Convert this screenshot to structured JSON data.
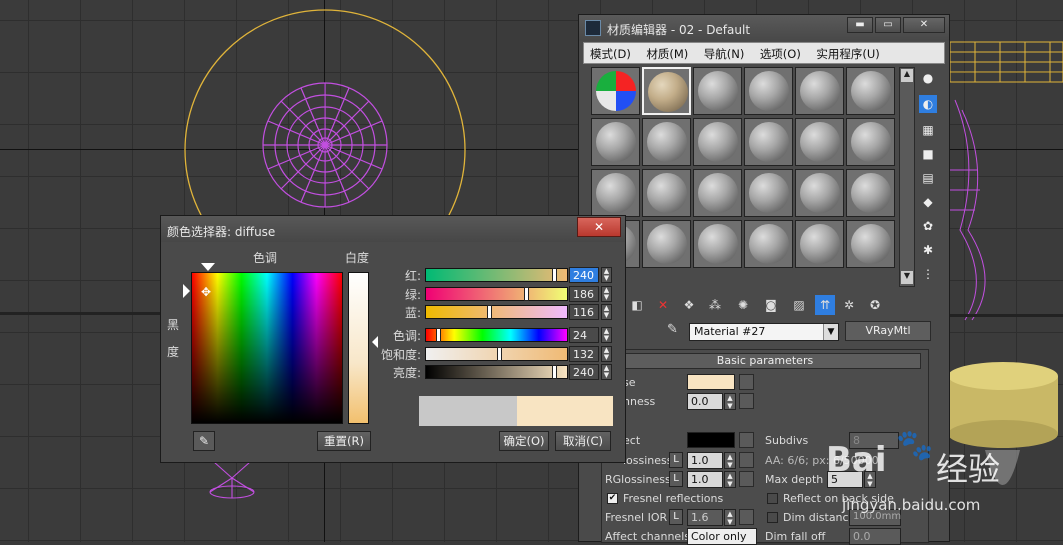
{
  "material_editor": {
    "title": "材质编辑器 - 02 - Default",
    "window_buttons": {
      "minimize": "▬",
      "restore": "▭",
      "close": "✕"
    },
    "menu": [
      "模式(D)",
      "材质(M)",
      "导航(N)",
      "选项(O)",
      "实用程序(U)"
    ],
    "material_name": "Material #27",
    "material_type": "VRayMtl",
    "rollout_title": "Basic parameters",
    "params": {
      "diffuse_label": "se",
      "roughness_label": "hness",
      "roughness_value": "0.0",
      "reflect_label": "ect",
      "subdivs_label": "Subdivs",
      "subdivs_value": "8",
      "glossiness_label": "lossiness",
      "glossiness_value": "1.0",
      "lock_label": "L",
      "aa_text": "AA: 6/6; px: 6/50000",
      "rglossiness_label": "RGlossiness",
      "rglossiness_value": "1.0",
      "maxdepth_label": "Max depth",
      "maxdepth_value": "5",
      "fresnel_label": "Fresnel reflections",
      "fresnel_checked": "✔",
      "reflect_backside_label": "Reflect on back side",
      "fresnel_ior_label": "Fresnel IOR",
      "fresnel_ior_value": "1.6",
      "dim_distance_label": "Dim distance",
      "dim_distance_value": "100.0mm",
      "affect_channels_label": "Affect channels",
      "affect_channels_value": "Color only",
      "dim_falloff_label": "Dim fall off",
      "dim_falloff_value": "0.0"
    }
  },
  "color_picker": {
    "title": "颜色选择器: diffuse",
    "close": "✕",
    "hue_label": "色调",
    "white_label": "白度",
    "black_label": "黑度",
    "sliders": [
      {
        "label": "红:",
        "value": "240"
      },
      {
        "label": "绿:",
        "value": "186"
      },
      {
        "label": "蓝:",
        "value": "116"
      },
      {
        "label": "色调:",
        "value": "24"
      },
      {
        "label": "饱和度:",
        "value": "132"
      },
      {
        "label": "亮度:",
        "value": "240"
      }
    ],
    "reset_button": "重置(R)",
    "ok_button": "确定(O)",
    "cancel_button": "取消(C)",
    "old_color": "#c8c8c8",
    "new_color": "#f8e4c2"
  },
  "watermark": {
    "logo": "Bai",
    "paw": "🐾",
    "suffix": "经验",
    "url": "jingyan.baidu.com"
  },
  "colors": {
    "wire_purple": "#c24fe0",
    "wire_yellow": "#e0b43a",
    "accent_blue": "#2f7ee0"
  }
}
